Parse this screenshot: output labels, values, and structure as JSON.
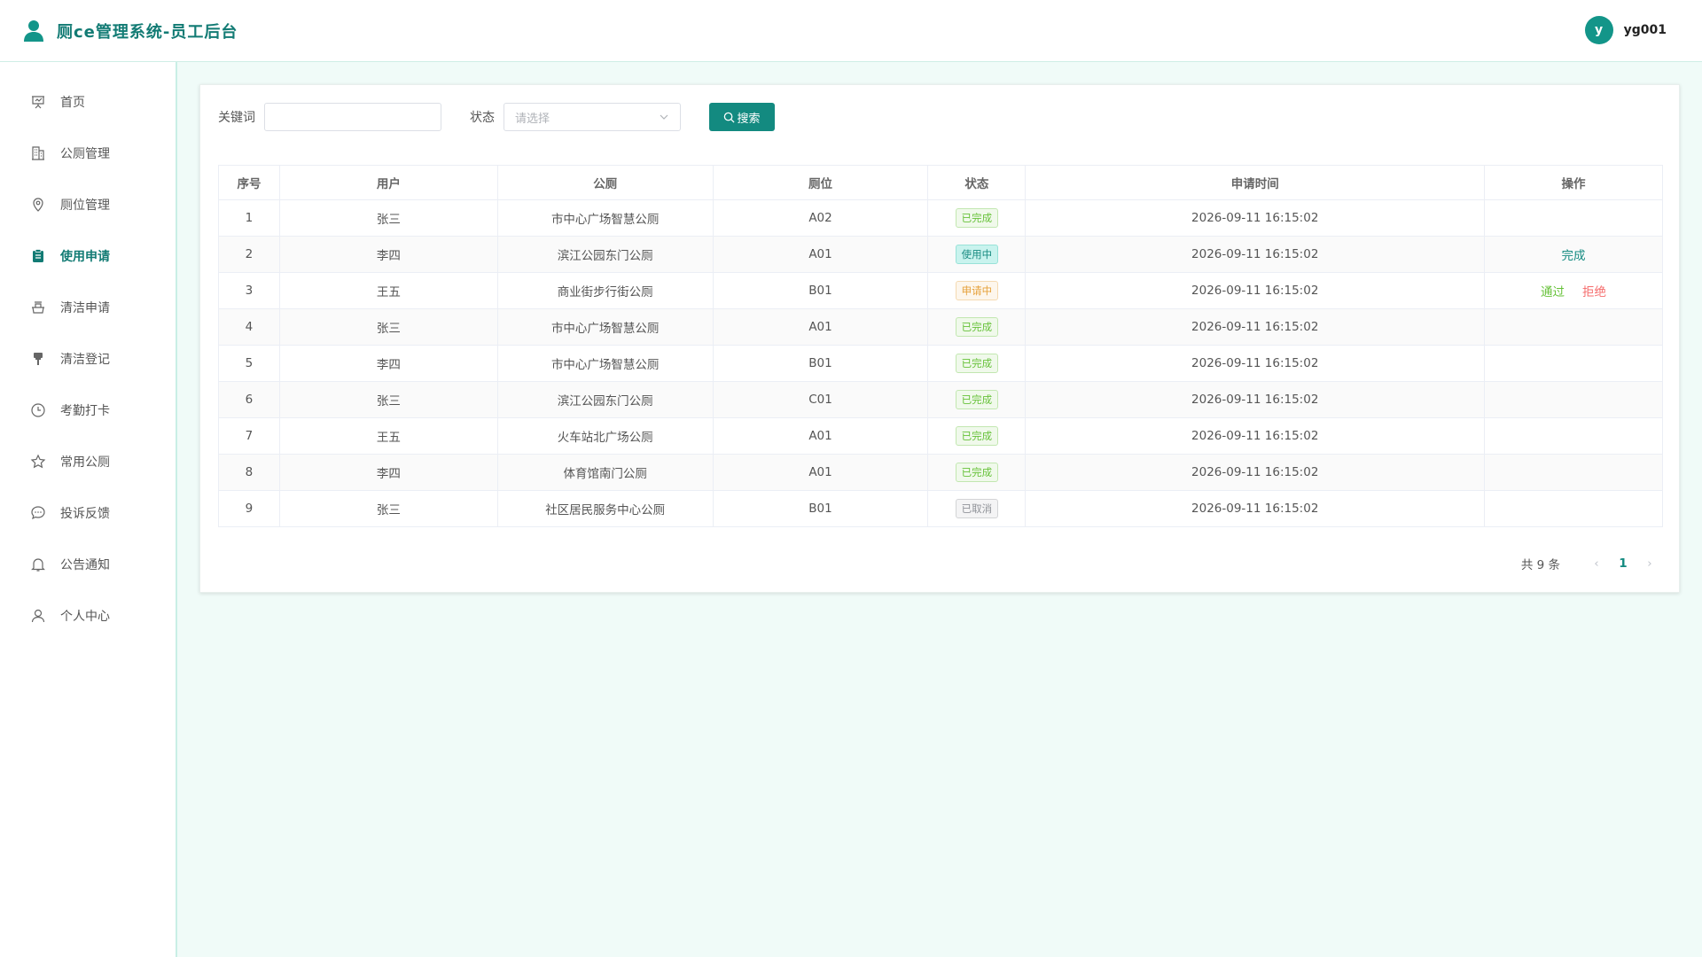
{
  "app": {
    "title": "厕ce管理系统-员工后台"
  },
  "user": {
    "initial": "y",
    "name": "yg001"
  },
  "sidebar": {
    "items": [
      {
        "label": "首页",
        "icon": "presentation-icon"
      },
      {
        "label": "公厕管理",
        "icon": "building-icon"
      },
      {
        "label": "厕位管理",
        "icon": "location-pin-icon"
      },
      {
        "label": "使用申请",
        "icon": "clipboard-icon",
        "active": true
      },
      {
        "label": "清洁申请",
        "icon": "cleaning-icon"
      },
      {
        "label": "清洁登记",
        "icon": "brush-icon"
      },
      {
        "label": "考勤打卡",
        "icon": "clock-icon"
      },
      {
        "label": "常用公厕",
        "icon": "star-icon"
      },
      {
        "label": "投诉反馈",
        "icon": "chat-icon"
      },
      {
        "label": "公告通知",
        "icon": "bell-icon"
      },
      {
        "label": "个人中心",
        "icon": "user-icon"
      }
    ]
  },
  "filters": {
    "keyword_label": "关键词",
    "keyword_value": "",
    "status_label": "状态",
    "status_placeholder": "请选择",
    "search_label": "搜索"
  },
  "table": {
    "headers": [
      "序号",
      "用户",
      "公厕",
      "厕位",
      "状态",
      "申请时间",
      "操作"
    ],
    "rows": [
      {
        "no": "1",
        "user": "张三",
        "toilet": "市中心广场智慧公厕",
        "stall": "A02",
        "status": "已完成",
        "time": "2026-09-11 16:15:02",
        "ops": []
      },
      {
        "no": "2",
        "user": "李四",
        "toilet": "滨江公园东门公厕",
        "stall": "A01",
        "status": "使用中",
        "time": "2026-09-11 16:15:02",
        "ops": [
          "完成"
        ]
      },
      {
        "no": "3",
        "user": "王五",
        "toilet": "商业街步行街公厕",
        "stall": "B01",
        "status": "申请中",
        "time": "2026-09-11 16:15:02",
        "ops": [
          "通过",
          "拒绝"
        ]
      },
      {
        "no": "4",
        "user": "张三",
        "toilet": "市中心广场智慧公厕",
        "stall": "A01",
        "status": "已完成",
        "time": "2026-09-11 16:15:02",
        "ops": []
      },
      {
        "no": "5",
        "user": "李四",
        "toilet": "市中心广场智慧公厕",
        "stall": "B01",
        "status": "已完成",
        "time": "2026-09-11 16:15:02",
        "ops": []
      },
      {
        "no": "6",
        "user": "张三",
        "toilet": "滨江公园东门公厕",
        "stall": "C01",
        "status": "已完成",
        "time": "2026-09-11 16:15:02",
        "ops": []
      },
      {
        "no": "7",
        "user": "王五",
        "toilet": "火车站北广场公厕",
        "stall": "A01",
        "status": "已完成",
        "time": "2026-09-11 16:15:02",
        "ops": []
      },
      {
        "no": "8",
        "user": "李四",
        "toilet": "体育馆南门公厕",
        "stall": "A01",
        "status": "已完成",
        "time": "2026-09-11 16:15:02",
        "ops": []
      },
      {
        "no": "9",
        "user": "张三",
        "toilet": "社区居民服务中心公厕",
        "stall": "B01",
        "status": "已取消",
        "time": "2026-09-11 16:15:02",
        "ops": []
      }
    ]
  },
  "pagination": {
    "total_text": "共 9 条",
    "current_page": "1",
    "prev_icon": "‹",
    "next_icon": "›"
  },
  "colors": {
    "primary": "#138a80",
    "success": "#67c23a",
    "warning": "#e6a23c",
    "danger": "#f56c6c",
    "info": "#909399"
  }
}
